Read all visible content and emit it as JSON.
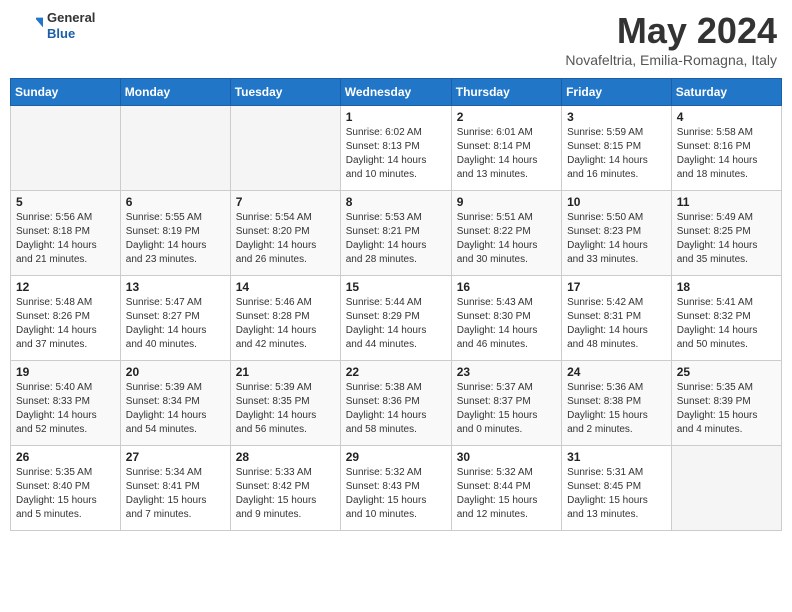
{
  "header": {
    "logo_general": "General",
    "logo_blue": "Blue",
    "title": "May 2024",
    "location": "Novafeltria, Emilia-Romagna, Italy"
  },
  "days_of_week": [
    "Sunday",
    "Monday",
    "Tuesday",
    "Wednesday",
    "Thursday",
    "Friday",
    "Saturday"
  ],
  "weeks": [
    [
      {
        "day": "",
        "info": ""
      },
      {
        "day": "",
        "info": ""
      },
      {
        "day": "",
        "info": ""
      },
      {
        "day": "1",
        "info": "Sunrise: 6:02 AM\nSunset: 8:13 PM\nDaylight: 14 hours\nand 10 minutes."
      },
      {
        "day": "2",
        "info": "Sunrise: 6:01 AM\nSunset: 8:14 PM\nDaylight: 14 hours\nand 13 minutes."
      },
      {
        "day": "3",
        "info": "Sunrise: 5:59 AM\nSunset: 8:15 PM\nDaylight: 14 hours\nand 16 minutes."
      },
      {
        "day": "4",
        "info": "Sunrise: 5:58 AM\nSunset: 8:16 PM\nDaylight: 14 hours\nand 18 minutes."
      }
    ],
    [
      {
        "day": "5",
        "info": "Sunrise: 5:56 AM\nSunset: 8:18 PM\nDaylight: 14 hours\nand 21 minutes."
      },
      {
        "day": "6",
        "info": "Sunrise: 5:55 AM\nSunset: 8:19 PM\nDaylight: 14 hours\nand 23 minutes."
      },
      {
        "day": "7",
        "info": "Sunrise: 5:54 AM\nSunset: 8:20 PM\nDaylight: 14 hours\nand 26 minutes."
      },
      {
        "day": "8",
        "info": "Sunrise: 5:53 AM\nSunset: 8:21 PM\nDaylight: 14 hours\nand 28 minutes."
      },
      {
        "day": "9",
        "info": "Sunrise: 5:51 AM\nSunset: 8:22 PM\nDaylight: 14 hours\nand 30 minutes."
      },
      {
        "day": "10",
        "info": "Sunrise: 5:50 AM\nSunset: 8:23 PM\nDaylight: 14 hours\nand 33 minutes."
      },
      {
        "day": "11",
        "info": "Sunrise: 5:49 AM\nSunset: 8:25 PM\nDaylight: 14 hours\nand 35 minutes."
      }
    ],
    [
      {
        "day": "12",
        "info": "Sunrise: 5:48 AM\nSunset: 8:26 PM\nDaylight: 14 hours\nand 37 minutes."
      },
      {
        "day": "13",
        "info": "Sunrise: 5:47 AM\nSunset: 8:27 PM\nDaylight: 14 hours\nand 40 minutes."
      },
      {
        "day": "14",
        "info": "Sunrise: 5:46 AM\nSunset: 8:28 PM\nDaylight: 14 hours\nand 42 minutes."
      },
      {
        "day": "15",
        "info": "Sunrise: 5:44 AM\nSunset: 8:29 PM\nDaylight: 14 hours\nand 44 minutes."
      },
      {
        "day": "16",
        "info": "Sunrise: 5:43 AM\nSunset: 8:30 PM\nDaylight: 14 hours\nand 46 minutes."
      },
      {
        "day": "17",
        "info": "Sunrise: 5:42 AM\nSunset: 8:31 PM\nDaylight: 14 hours\nand 48 minutes."
      },
      {
        "day": "18",
        "info": "Sunrise: 5:41 AM\nSunset: 8:32 PM\nDaylight: 14 hours\nand 50 minutes."
      }
    ],
    [
      {
        "day": "19",
        "info": "Sunrise: 5:40 AM\nSunset: 8:33 PM\nDaylight: 14 hours\nand 52 minutes."
      },
      {
        "day": "20",
        "info": "Sunrise: 5:39 AM\nSunset: 8:34 PM\nDaylight: 14 hours\nand 54 minutes."
      },
      {
        "day": "21",
        "info": "Sunrise: 5:39 AM\nSunset: 8:35 PM\nDaylight: 14 hours\nand 56 minutes."
      },
      {
        "day": "22",
        "info": "Sunrise: 5:38 AM\nSunset: 8:36 PM\nDaylight: 14 hours\nand 58 minutes."
      },
      {
        "day": "23",
        "info": "Sunrise: 5:37 AM\nSunset: 8:37 PM\nDaylight: 15 hours\nand 0 minutes."
      },
      {
        "day": "24",
        "info": "Sunrise: 5:36 AM\nSunset: 8:38 PM\nDaylight: 15 hours\nand 2 minutes."
      },
      {
        "day": "25",
        "info": "Sunrise: 5:35 AM\nSunset: 8:39 PM\nDaylight: 15 hours\nand 4 minutes."
      }
    ],
    [
      {
        "day": "26",
        "info": "Sunrise: 5:35 AM\nSunset: 8:40 PM\nDaylight: 15 hours\nand 5 minutes."
      },
      {
        "day": "27",
        "info": "Sunrise: 5:34 AM\nSunset: 8:41 PM\nDaylight: 15 hours\nand 7 minutes."
      },
      {
        "day": "28",
        "info": "Sunrise: 5:33 AM\nSunset: 8:42 PM\nDaylight: 15 hours\nand 9 minutes."
      },
      {
        "day": "29",
        "info": "Sunrise: 5:32 AM\nSunset: 8:43 PM\nDaylight: 15 hours\nand 10 minutes."
      },
      {
        "day": "30",
        "info": "Sunrise: 5:32 AM\nSunset: 8:44 PM\nDaylight: 15 hours\nand 12 minutes."
      },
      {
        "day": "31",
        "info": "Sunrise: 5:31 AM\nSunset: 8:45 PM\nDaylight: 15 hours\nand 13 minutes."
      },
      {
        "day": "",
        "info": ""
      }
    ]
  ]
}
